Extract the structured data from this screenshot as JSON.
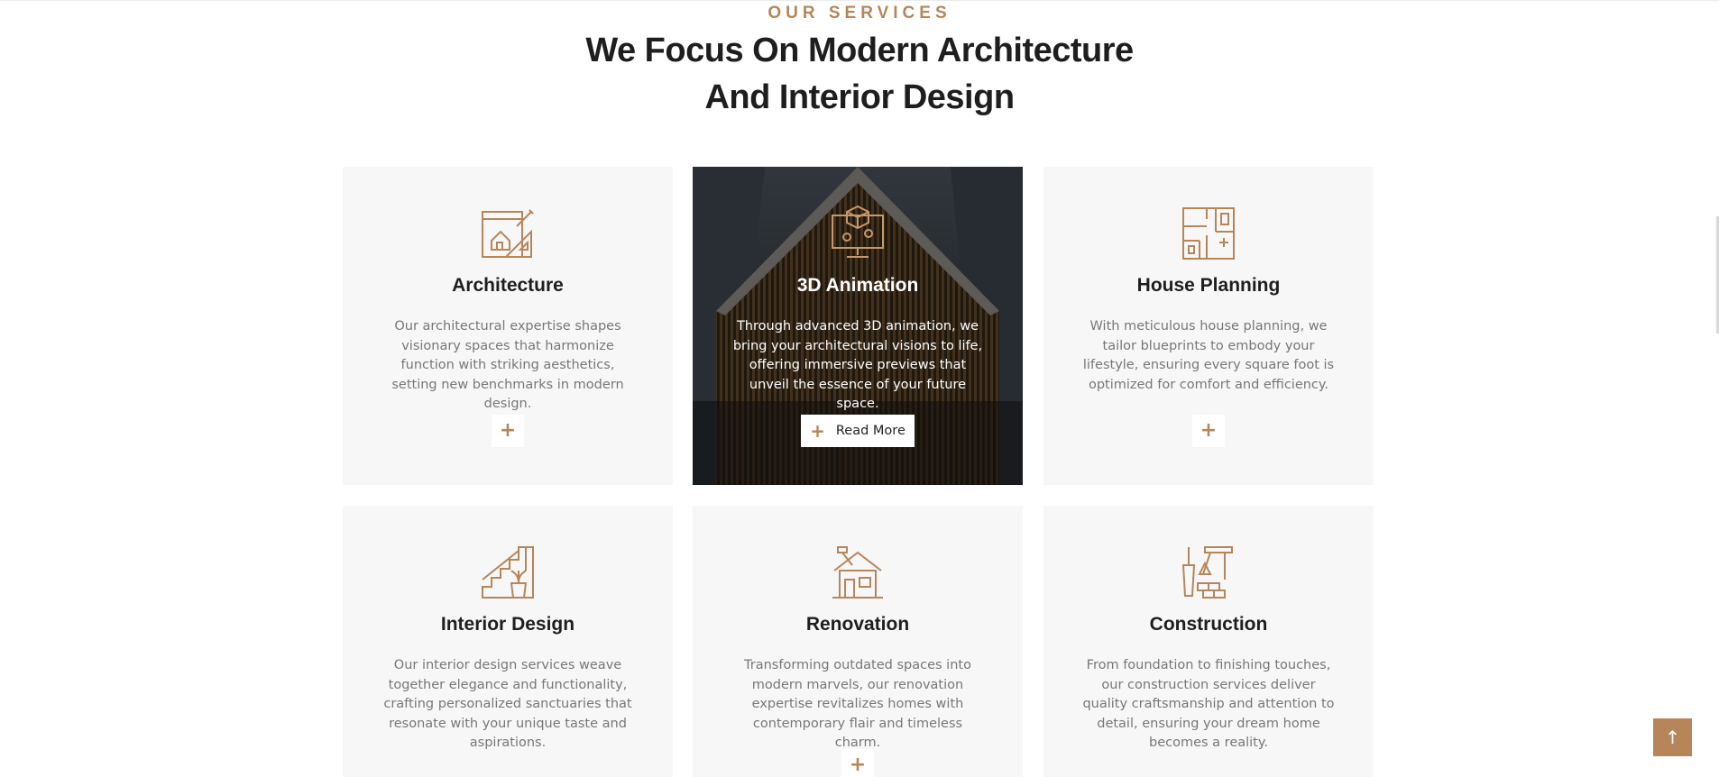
{
  "section": {
    "eyebrow": "OUR SERVICES",
    "heading_line1": "We Focus On Modern Architecture",
    "heading_line2": "And Interior Design"
  },
  "services": [
    {
      "title": "Architecture",
      "icon": "blueprint-icon",
      "description": "Our architectural expertise shapes visionary spaces that harmonize function with striking aesthetics, setting new benchmarks in modern design.",
      "button": "+"
    },
    {
      "title": "3D Animation",
      "icon": "3d-monitor-icon",
      "description": "Through advanced 3D animation, we bring your architectural visions to life, offering immersive previews that unveil the essence of your future space.",
      "button": "Read More",
      "button_icon": "+"
    },
    {
      "title": "House Planning",
      "icon": "floor-plan-icon",
      "description": "With meticulous house planning, we tailor blueprints to embody your lifestyle, ensuring every square foot is optimized for comfort and efficiency.",
      "button": "+"
    },
    {
      "title": "Interior Design",
      "icon": "stairs-plant-icon",
      "description": "Our interior design services weave together elegance and functionality, crafting personalized sanctuaries that resonate with your unique taste and aspirations.",
      "button": "+"
    },
    {
      "title": "Renovation",
      "icon": "house-hammer-icon",
      "description": "Transforming outdated spaces into modern marvels, our renovation expertise revitalizes homes with contemporary flair and timeless charm.",
      "button": "+"
    },
    {
      "title": "Construction",
      "icon": "crane-bricks-icon",
      "description": "From foundation to finishing touches, our construction services deliver quality craftsmanship and attention to detail, ensuring your dream home becomes a reality.",
      "button": "+"
    }
  ],
  "scroll_top_icon": "↑",
  "colors": {
    "accent": "#b6865a",
    "card_bg": "#f7f7f7",
    "heading": "#1e1e1e"
  }
}
